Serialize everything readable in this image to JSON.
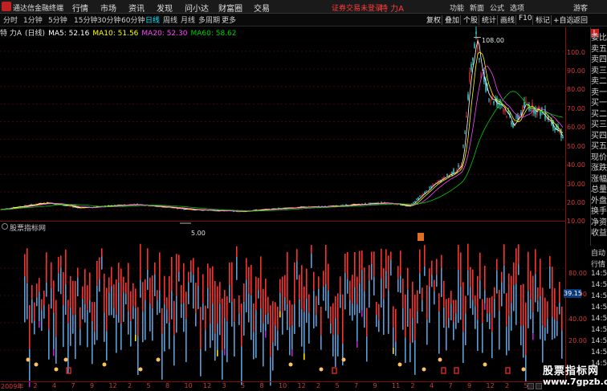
{
  "menubar": {
    "app_title": "通达信金融终端",
    "items": [
      "行情",
      "市场",
      "资讯",
      "发现",
      "问小达",
      "财富圈",
      "交易"
    ],
    "login_status": "证券交易未登录",
    "stock_name": "特 力A",
    "right_items": [
      "功能",
      "新面",
      "公式",
      "选项"
    ],
    "guest": "游客"
  },
  "periodbar": {
    "periods": [
      "分时",
      "1分钟",
      "5分钟",
      "15分钟",
      "30分钟",
      "60分钟",
      "日线",
      "周线",
      "月线",
      "多周期",
      "更多"
    ],
    "active": "日线",
    "tools": [
      "复权",
      "叠加",
      "个股",
      "统计",
      "画线",
      "F10",
      "标记",
      "+自选",
      "返回"
    ]
  },
  "infoline": {
    "label": "特 力A",
    "period": "(日线)",
    "ma5": "MA5: 52.16",
    "ma10": "MA10: 51.56",
    "ma20": "MA20: 52.30",
    "ma60": "MA60: 58.62"
  },
  "colors": {
    "up": "#ff3b3b",
    "down": "#54ffff",
    "ma5": "#ffffff",
    "ma10": "#ffff00",
    "ma20": "#ff44ff",
    "ma60": "#00cc00",
    "indicator_red": "#ff3030",
    "indicator_blue": "#5a9fd8",
    "indicator_yellow": "#ffe000",
    "indicator_purple": "#c020d0"
  },
  "price_axis": [
    "100.0",
    "90.00",
    "80.00",
    "70.00",
    "60.00",
    "50.00",
    "40.00",
    "30.00",
    "20.00",
    "10.00"
  ],
  "price_annotations": {
    "high": "108.00",
    "low": "5.00"
  },
  "indicator": {
    "title": "股票指标网",
    "axis": [
      "80.00",
      "60.00",
      "40.00",
      "20.00"
    ],
    "current_value": "39.15"
  },
  "side_panel": {
    "items": [
      "委比",
      "卖五",
      "卖四",
      "卖三",
      "卖二",
      "卖一",
      "买一",
      "买二",
      "买三",
      "买四",
      "买五",
      "现价",
      "涨跌",
      "涨幅",
      "总量",
      "外盘",
      "换手",
      "净资",
      "收益"
    ],
    "feed": [
      "自动",
      "行情",
      "14:56",
      "14:56",
      "14:56",
      "14:56",
      "14:56",
      "14:56",
      "14:56",
      "14:56",
      "14:56"
    ]
  },
  "date_axis": [
    "2009年",
    "2",
    "4",
    "7",
    "9",
    "12",
    "2",
    "5",
    "8",
    "10",
    "12",
    "3",
    "5",
    "8",
    "10",
    "12",
    "2",
    "5",
    "7",
    "9",
    "11",
    "2",
    "4",
    "7",
    "9",
    "12",
    "2",
    "5"
  ],
  "watermark": {
    "title": "股票指标网",
    "url": "www.7gpzb.com"
  },
  "chart_data": [
    {
      "type": "candlestick",
      "title": "特 力A (日线)",
      "ylim": [
        0,
        110
      ],
      "y_ticks": [
        10,
        20,
        30,
        40,
        50,
        60,
        70,
        80,
        90,
        100
      ],
      "series": [
        {
          "name": "MA5",
          "values": [
            52.16
          ]
        },
        {
          "name": "MA10",
          "values": [
            51.56
          ]
        },
        {
          "name": "MA20",
          "values": [
            52.3
          ]
        },
        {
          "name": "MA60",
          "values": [
            58.62
          ]
        }
      ],
      "price_path": [
        [
          0,
          10
        ],
        [
          60,
          14
        ],
        [
          100,
          11
        ],
        [
          170,
          13
        ],
        [
          240,
          10
        ],
        [
          300,
          9
        ],
        [
          360,
          11
        ],
        [
          420,
          12
        ],
        [
          480,
          14
        ],
        [
          510,
          12
        ],
        [
          540,
          24
        ],
        [
          560,
          30
        ],
        [
          575,
          35
        ],
        [
          585,
          85
        ],
        [
          593,
          108
        ],
        [
          600,
          88
        ],
        [
          610,
          74
        ],
        [
          625,
          70
        ],
        [
          640,
          58
        ],
        [
          655,
          70
        ],
        [
          680,
          64
        ],
        [
          700,
          52
        ]
      ],
      "annotations": [
        {
          "label": "108.00"
        },
        {
          "label": "5.00"
        }
      ]
    },
    {
      "type": "bar",
      "title": "股票指标网",
      "ylim": [
        0,
        100
      ],
      "y_ticks": [
        20,
        40,
        60,
        80
      ],
      "current": 39.15
    }
  ]
}
